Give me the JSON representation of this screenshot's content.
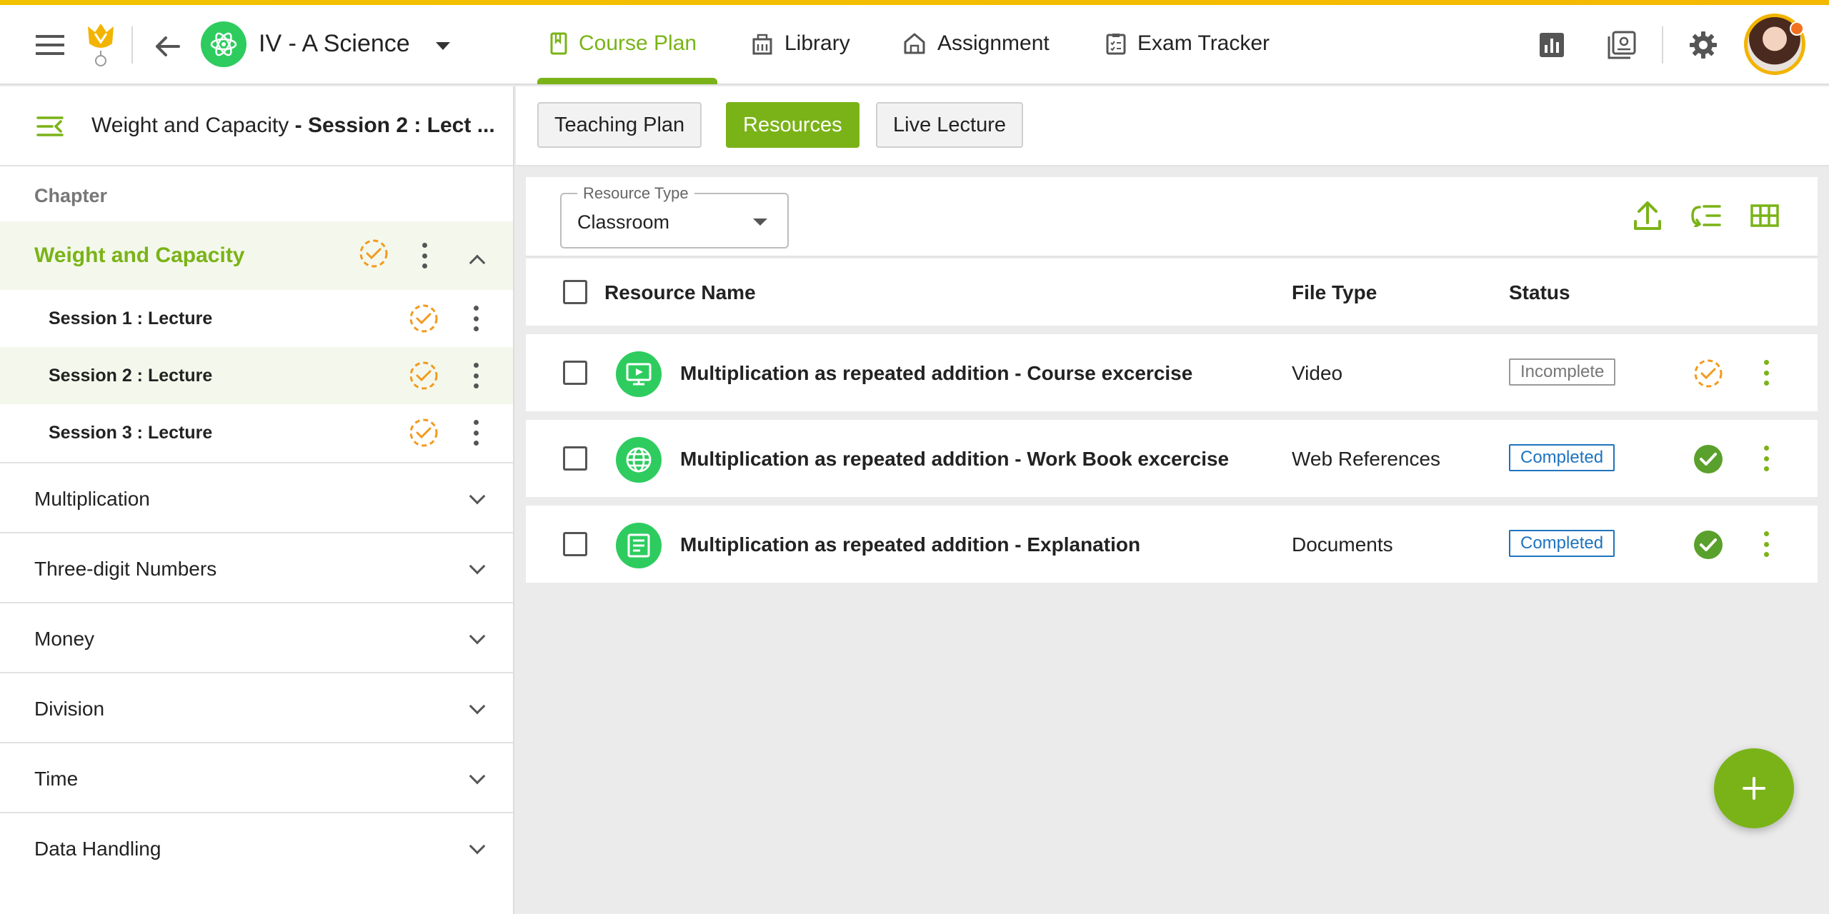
{
  "header": {
    "class_name": "IV - A Science",
    "nav": [
      {
        "label": "Course Plan",
        "active": true
      },
      {
        "label": "Library",
        "active": false
      },
      {
        "label": "Assignment",
        "active": false
      },
      {
        "label": "Exam Tracker",
        "active": false
      }
    ]
  },
  "sidebar": {
    "breadcrumb_chapter": "Weight and Capacity",
    "breadcrumb_session": " - Session 2 : Lect ...",
    "chapter_label": "Chapter",
    "active_chapter": {
      "title": "Weight and Capacity",
      "sessions": [
        {
          "label": "Session 1 : Lecture",
          "selected": false
        },
        {
          "label": "Session 2 : Lecture",
          "selected": true
        },
        {
          "label": "Session 3 : Lecture",
          "selected": false
        }
      ]
    },
    "chapters": [
      "Multiplication",
      "Three-digit Numbers",
      "Money",
      "Division",
      "Time",
      "Data Handling"
    ]
  },
  "tabs": [
    {
      "label": "Teaching Plan",
      "active": false
    },
    {
      "label": "Resources",
      "active": true
    },
    {
      "label": "Live Lecture",
      "active": false
    }
  ],
  "filter": {
    "legend": "Resource Type",
    "value": "Classroom"
  },
  "table": {
    "columns": {
      "name": "Resource Name",
      "type": "File Type",
      "status": "Status"
    },
    "rows": [
      {
        "name": "Multiplication as repeated addition - Course excercise",
        "type": "Video",
        "status": "Incomplete",
        "icon": "video-icon"
      },
      {
        "name": "Multiplication as repeated addition - Work Book excercise",
        "type": "Web References",
        "status": "Completed",
        "icon": "globe-icon"
      },
      {
        "name": "Multiplication as repeated addition - Explanation",
        "type": "Documents",
        "status": "Completed",
        "icon": "document-icon"
      }
    ]
  },
  "colors": {
    "accent": "#7ab317",
    "top_strip": "#f2c200",
    "pending": "#f39a1e",
    "completed_badge": "#1e73be",
    "class_badge": "#2ecc5f"
  }
}
